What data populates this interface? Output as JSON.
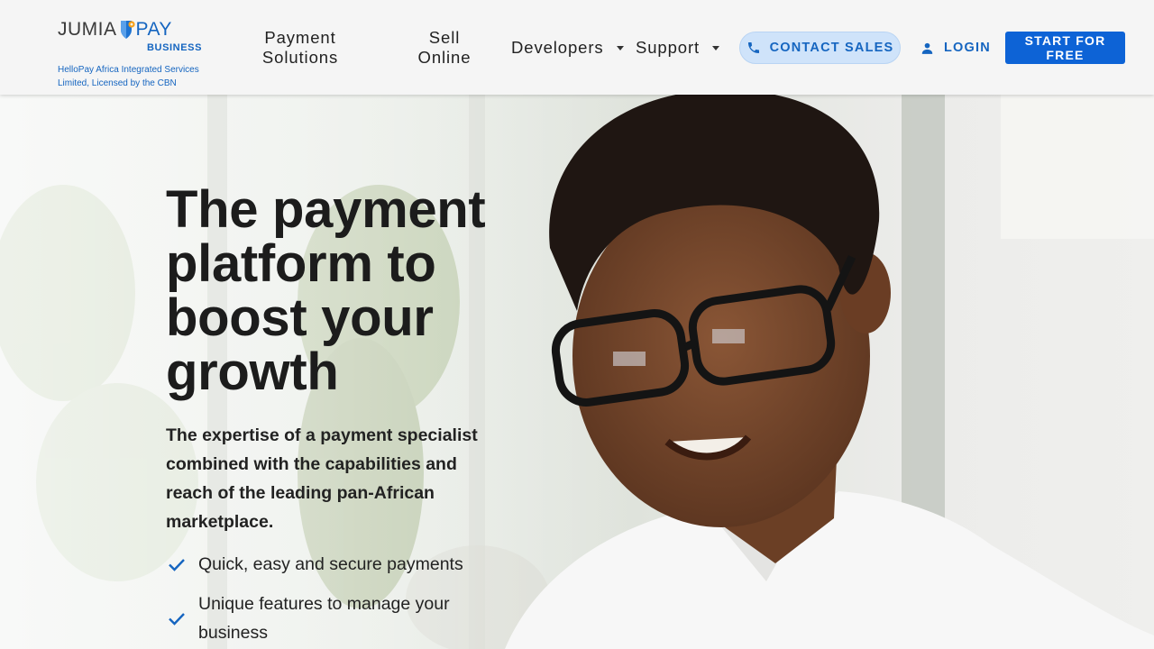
{
  "brand": {
    "logo_left": "JUMIA",
    "logo_right": "PAY",
    "logo_sub": "BUSINESS",
    "license": "HelloPay Africa Integrated Services Limited, Licensed by the CBN",
    "colors": {
      "primary": "#1565c0",
      "accent": "#f7a11a",
      "button": "#0d63d6",
      "contact_bg": "#cfe3fa"
    }
  },
  "nav": {
    "payment_solutions": "Payment Solutions",
    "sell_online": "Sell Online",
    "developers": "Developers",
    "support": "Support"
  },
  "actions": {
    "contact_sales": "CONTACT SALES",
    "login": "LOGIN",
    "start_free": "START FOR FREE"
  },
  "icons": {
    "contact": "phone-icon",
    "login": "person-icon",
    "dropdown": "caret-down-icon",
    "feature": "check-icon"
  },
  "hero": {
    "title": "The payment platform to boost your growth",
    "subtitle": "The expertise of a payment specialist combined with the capabilities and reach of the leading pan-African marketplace.",
    "features": [
      "Quick, easy and secure payments",
      "Unique features to manage your business"
    ]
  }
}
